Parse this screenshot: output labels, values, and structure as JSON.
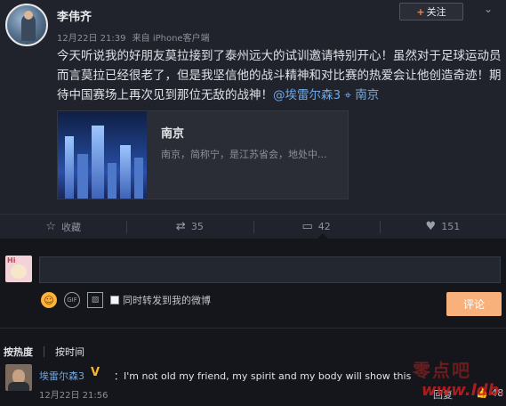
{
  "post": {
    "author": "李伟齐",
    "time": "12月22日 21:39",
    "source": "来自 iPhone客户端",
    "follow_label": "关注",
    "text_main": "今天听说我的好朋友莫拉接到了泰州远大的试训邀请特别开心！虽然对于足球运动员而言莫拉已经很老了，但是我坚信他的战斗精神和对比赛的热爱会让他创造奇迹！期待中国赛场上再次见到那位无敌的战神！",
    "mention": "@埃雷尔森3",
    "location": "南京",
    "card": {
      "title": "南京",
      "desc": "南京，简称宁，是江苏省会，地处中..."
    }
  },
  "actions": {
    "favorite": "收藏",
    "repost": "35",
    "comment": "42",
    "like": "151"
  },
  "composer": {
    "input_placeholder": "",
    "avatar_text": "Hi",
    "forward_label": "同时转发到我的微博",
    "submit_label": "评论"
  },
  "sort": {
    "hot": "按热度",
    "time": "按时间"
  },
  "comments": [
    {
      "user": "埃雷尔森3",
      "badge": "V",
      "text": "：I'm not old my friend, my spirit and my body will show this",
      "time": "12月22日 21:56",
      "reply": "回复",
      "likes": "48"
    }
  ],
  "watermark": {
    "cn": "零点吧",
    "en": "www.ldb.cc"
  },
  "icons": {
    "follow": "plus-icon",
    "menu": "chevron-down-icon",
    "location": "location-pin-icon",
    "favorite": "star-icon",
    "repost": "repost-icon",
    "comment": "comment-icon",
    "like": "thumbs-up-icon",
    "emoji": "emoji-icon",
    "gif": "gif-icon",
    "image": "image-icon"
  },
  "colors": {
    "accent_orange": "#ff8140",
    "link_blue": "#6fa8e6",
    "submit_bg": "#f9b17c",
    "badge_gold": "#f5b82e"
  }
}
